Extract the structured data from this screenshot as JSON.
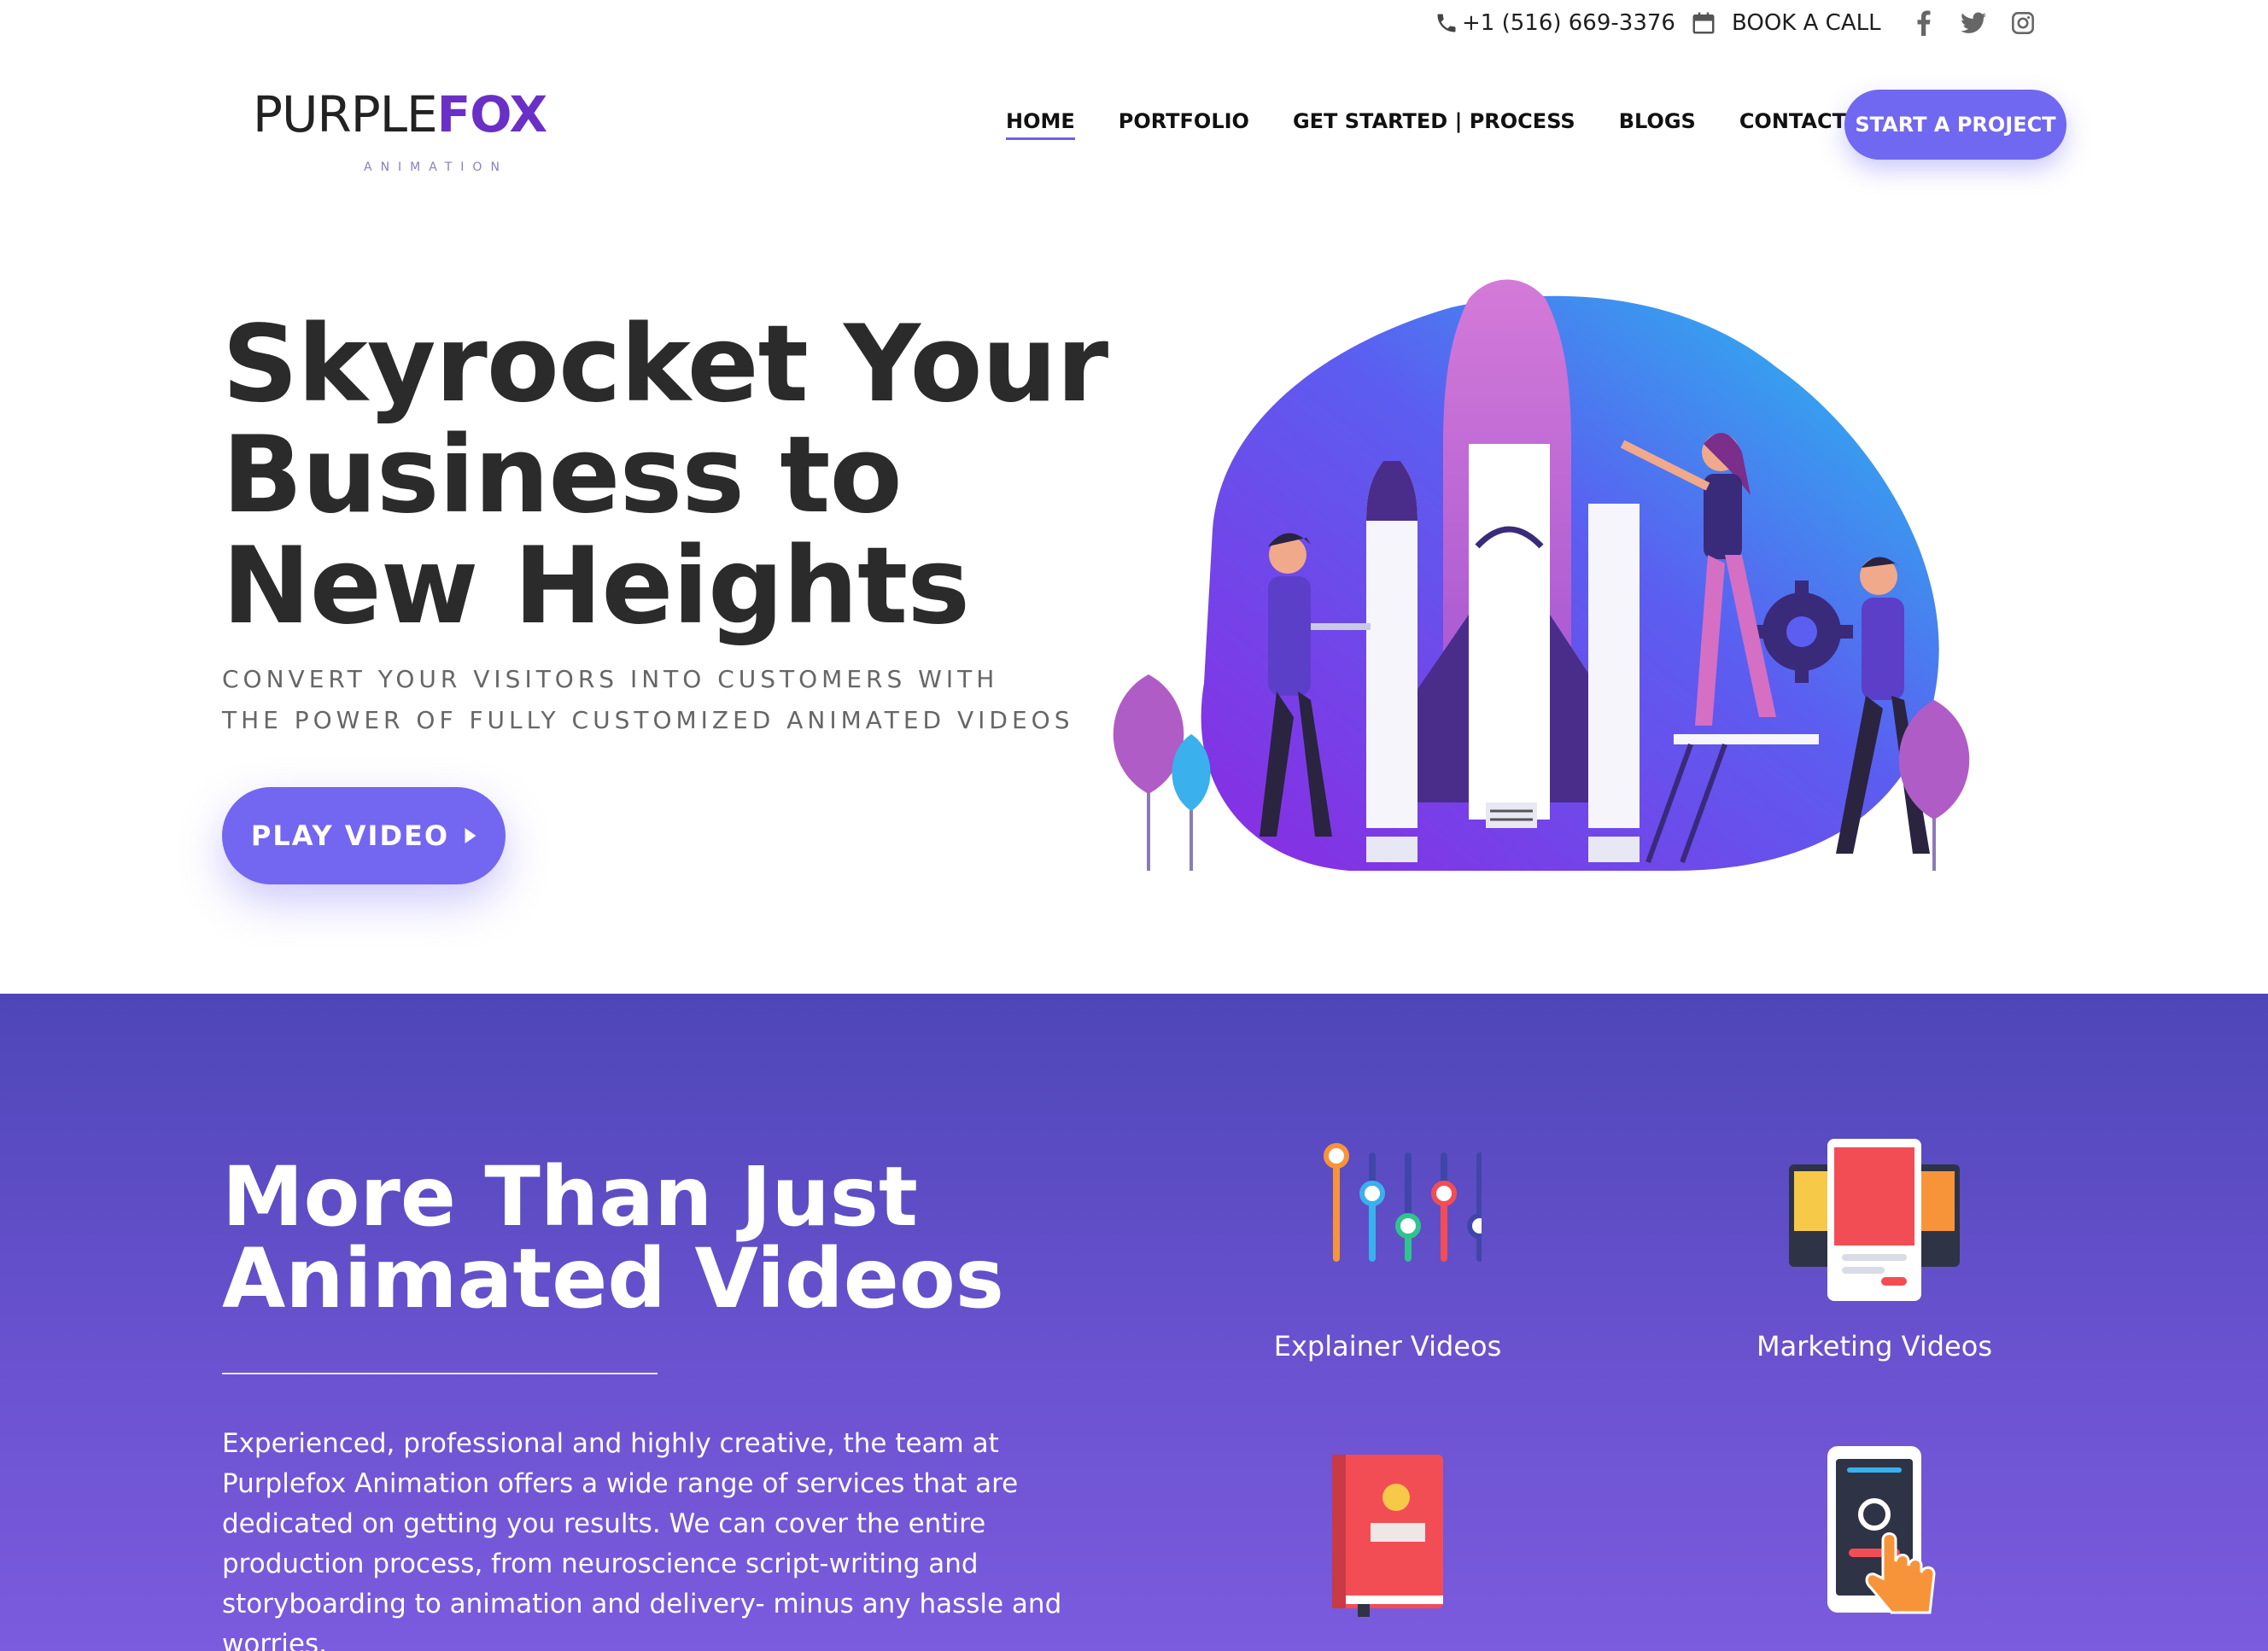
{
  "topbar": {
    "phone": "+1 (516) 669-3376",
    "book_call": "BOOK A CALL",
    "social_icons": [
      "facebook-icon",
      "twitter-icon",
      "instagram-icon"
    ]
  },
  "header": {
    "logo_main": "PURPLE",
    "logo_accent": "FOX",
    "logo_sub": "ANIMATION",
    "nav": [
      {
        "label": "HOME",
        "active": true
      },
      {
        "label": "PORTFOLIO",
        "active": false
      },
      {
        "label": "GET STARTED | PROCESS",
        "active": false
      },
      {
        "label": "BLOGS",
        "active": false
      },
      {
        "label": "CONTACT US",
        "active": false
      }
    ],
    "cta_label": "START A PROJECT"
  },
  "hero": {
    "title_line1": "Skyrocket Your",
    "title_line2": "Business to",
    "title_line3": "New Heights",
    "subtitle_line1": "CONVERT YOUR VISITORS INTO CUSTOMERS WITH",
    "subtitle_line2": "THE POWER OF FULLY CUSTOMIZED ANIMATED VIDEOS",
    "play_label": "PLAY VIDEO"
  },
  "services": {
    "title_line1": "More Than Just",
    "title_line2": "Animated Videos",
    "description": "Experienced, professional and highly creative, the team at Purplefox Animation offers a wide range of services that are dedicated on getting you results. We can cover the entire production process, from neuroscience script-writing and storyboarding to animation and delivery- minus any hassle and worries.",
    "items": [
      {
        "label": "Explainer Videos",
        "icon": "sliders-icon"
      },
      {
        "label": "Marketing Videos",
        "icon": "devices-icon"
      },
      {
        "label": "",
        "icon": "book-icon"
      },
      {
        "label": "",
        "icon": "phone-touch-icon"
      }
    ]
  },
  "colors": {
    "accent": "#7068f0",
    "brand_purple": "#6a2fc6",
    "section_top": "#4e46b8",
    "section_bottom": "#7b5bde"
  }
}
